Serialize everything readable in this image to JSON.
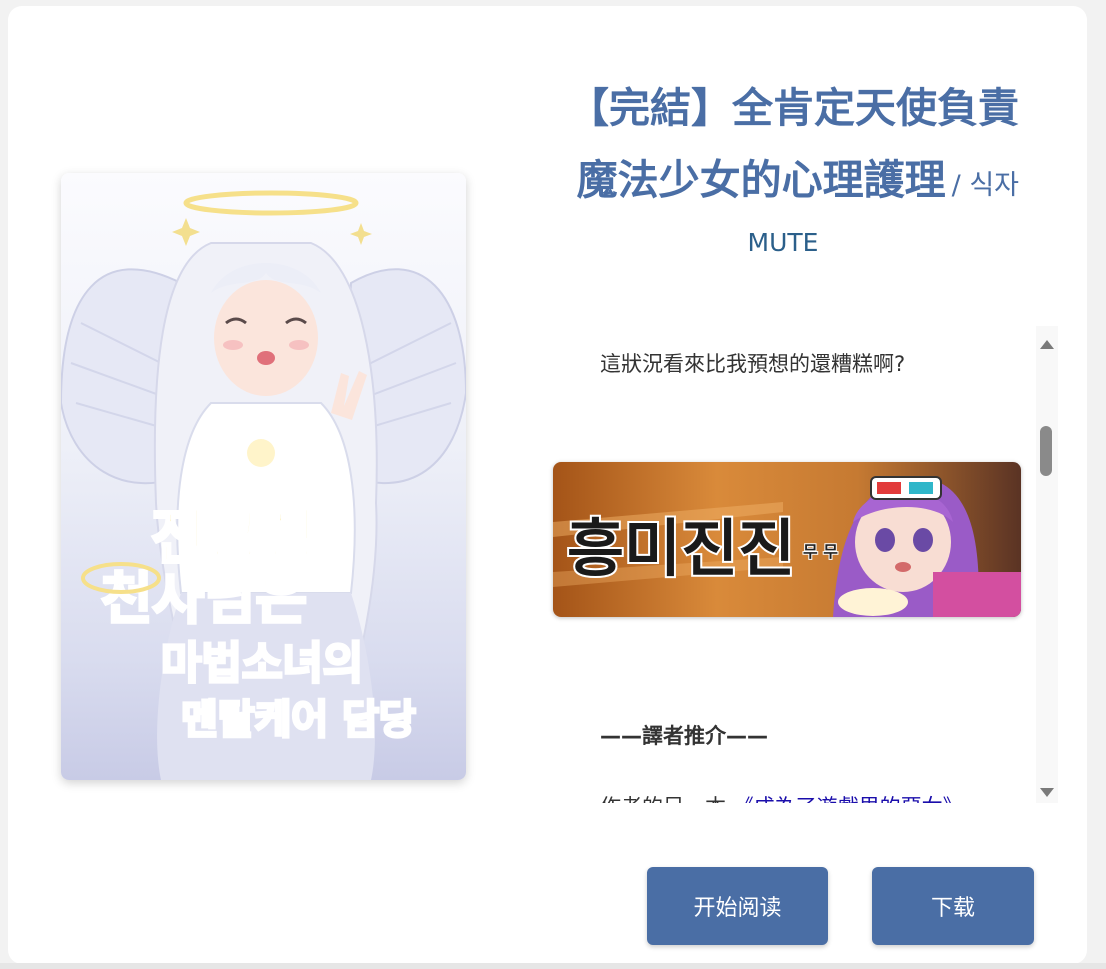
{
  "book": {
    "title_line1": "【完結】全肯定天使負責",
    "title_line2": "魔法少女的心理護理",
    "original_title": "/ 식자",
    "author": "MUTE",
    "cover_text": [
      "전긍정",
      "천사님은",
      "마법소녀의",
      "멘탈케어 담당"
    ]
  },
  "description": {
    "line1": "這狀況看來比我預想的還糟糕啊?",
    "sticker_text": "흥미진진",
    "sticker_side_text": "무 무",
    "section_heading": "——譯者推介——",
    "line3_prefix": "作者的另一本",
    "line3_link": "《成為了遊戲里的惡女》"
  },
  "actions": {
    "read_label": "开始阅读",
    "download_label": "下载"
  },
  "colors": {
    "accent": "#4a6ea5",
    "author": "#2b5f8a",
    "link": "#1a0dab"
  }
}
